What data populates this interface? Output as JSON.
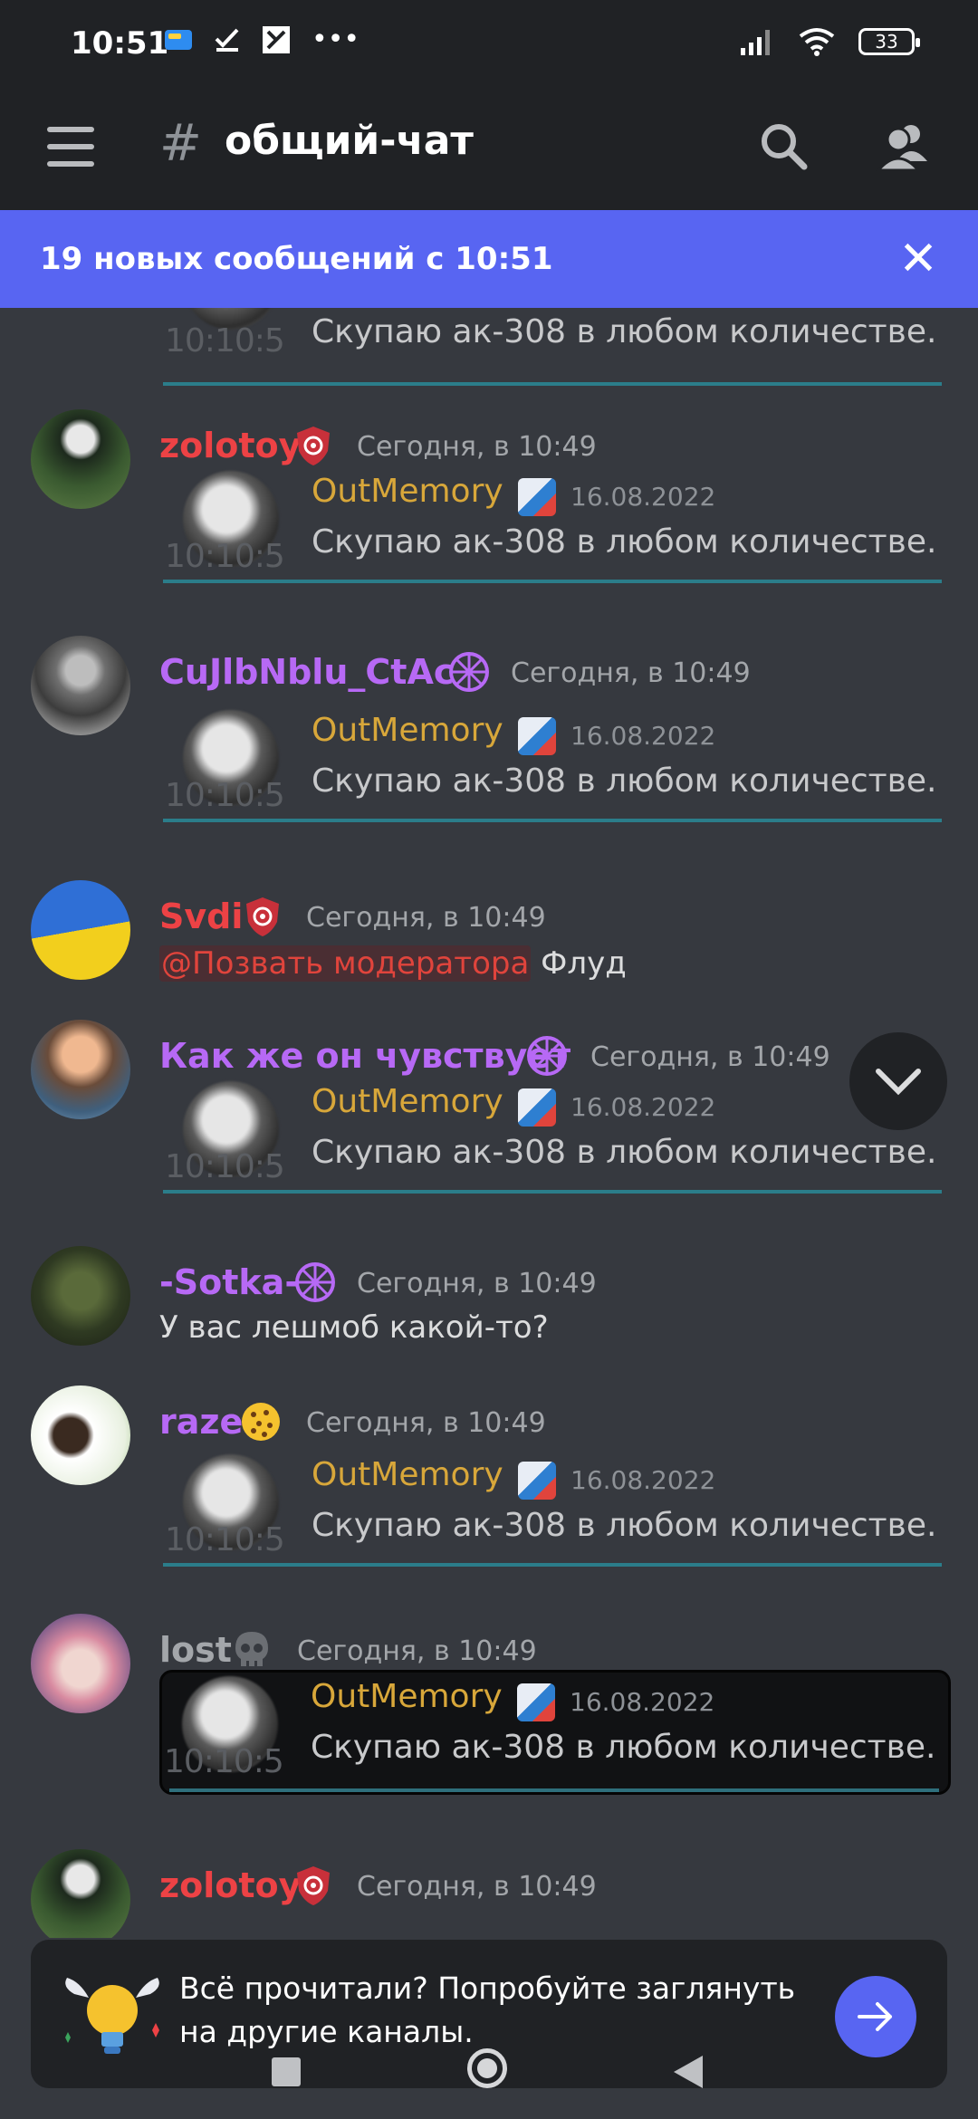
{
  "status": {
    "time": "10:51",
    "more": "•••",
    "battery": "33"
  },
  "header": {
    "hash": "#",
    "title": "общий-чат"
  },
  "new_messages": {
    "text": "19 новых сообщений с 10:51",
    "close": "✕"
  },
  "embed": {
    "author": "OutMemory",
    "date": "16.08.2022",
    "text": "Скупаю ак-308 в любом количестве.",
    "ghost": "10:10:5"
  },
  "messages": [
    {
      "user": "zolotoy",
      "color": "#ed4245",
      "time": "Сегодня, в 10:49"
    },
    {
      "user": "CuJlbNblu_CtAc",
      "color": "#b769f5",
      "time": "Сегодня, в 10:49"
    },
    {
      "user": "Svdi",
      "color": "#ed4245",
      "time": "Сегодня, в 10:49",
      "mention": "@Позвать модератора",
      "text": " Флуд"
    },
    {
      "user": "Как же он чувствует",
      "color": "#b769f5",
      "time": "Сегодня, в 10:49"
    },
    {
      "user": "-Sotka-",
      "color": "#b769f5",
      "time": "Сегодня, в 10:49",
      "text": "У вас лешмоб какой-то?"
    },
    {
      "user": "raze",
      "color": "#b769f5",
      "time": "Сегодня, в 10:49"
    },
    {
      "user": "lost",
      "color": "#a3a6aa",
      "time": "Сегодня, в 10:49"
    },
    {
      "user": "zolotoy",
      "color": "#ed4245",
      "time": "Сегодня, в 10:49"
    }
  ],
  "bottom": {
    "text": "Всё прочитали? Попробуйте заглянуть на другие каналы."
  },
  "colors": {
    "accent": "#5865f2",
    "background": "#36393f",
    "header": "#202225"
  }
}
